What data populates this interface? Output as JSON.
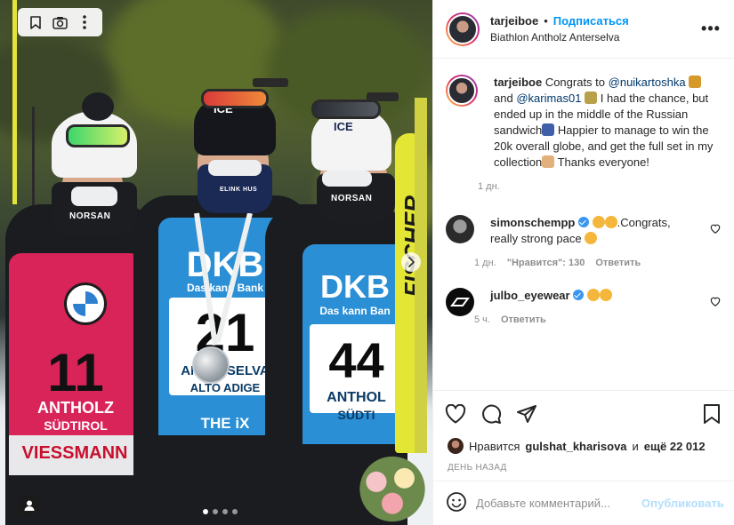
{
  "photo": {
    "toolbar": {
      "icons": [
        "bookmark-icon",
        "camera-search-icon",
        "more-vertical-icon"
      ]
    },
    "athletes": [
      {
        "hat": "",
        "mask": "NORSAN",
        "bib_number": "11",
        "bib_text": [
          "ANTHOLZ",
          "SÜDTIROL",
          "VIESSMANN"
        ]
      },
      {
        "hat": "ICE",
        "mask": "ELINK HUS",
        "bib_number": "21",
        "bib_text": [
          "DKB",
          "Das kann Bank",
          "ANTHOLZ",
          "ANTERSELVA",
          "ALTO ADIGE",
          "THE iX"
        ]
      },
      {
        "hat": "ICE",
        "mask": "NORSAN",
        "bib_number": "44",
        "bib_text": [
          "DKB",
          "Das kann Ban",
          "ANTHOL",
          "SÜDTI"
        ]
      }
    ],
    "ski_brand": "FISCHER",
    "carousel": {
      "count": 4,
      "active": 0
    }
  },
  "header": {
    "username": "tarjeiboe",
    "separator": "•",
    "follow_label": "Подписаться",
    "location": "Biathlon Antholz Anterselva",
    "more_label": "•••"
  },
  "caption": {
    "username": "tarjeiboe",
    "text_parts": {
      "p1": "Congrats to ",
      "mention1": "@nuikartoshka",
      "p2": " and ",
      "mention2": "@karimas01",
      "p3": " I had the chance, but ended up in the middle of the Russian sandwich",
      "p4": " Happier to manage to win the 20k overall globe, and get the full set in my collection",
      "p5": " Thanks everyone!"
    },
    "time": "1 дн."
  },
  "comments": [
    {
      "username": "simonschempp",
      "text": ".Congrats, really strong pace",
      "time": "1 дн.",
      "likes_label": "\"Нравится\": 130",
      "reply_label": "Ответить"
    },
    {
      "username": "julbo_eyewear",
      "text": "",
      "time": "5 ч.",
      "reply_label": "Ответить"
    }
  ],
  "actions": {
    "icons": [
      "heart-icon",
      "comment-icon",
      "share-icon",
      "bookmark-icon"
    ]
  },
  "likes": {
    "prefix": "Нравится",
    "user": "gulshat_kharisova",
    "middle": "и",
    "others": "ещё 22 012"
  },
  "date": "ДЕНЬ НАЗАД",
  "add_comment": {
    "placeholder": "Добавьте комментарий...",
    "publish_label": "Опубликовать"
  },
  "colors": {
    "accent": "#0095f6",
    "link": "#00376b",
    "muted": "#8e8e8e",
    "publish_disabled": "#b2dffc",
    "verified": "#3897f0"
  }
}
